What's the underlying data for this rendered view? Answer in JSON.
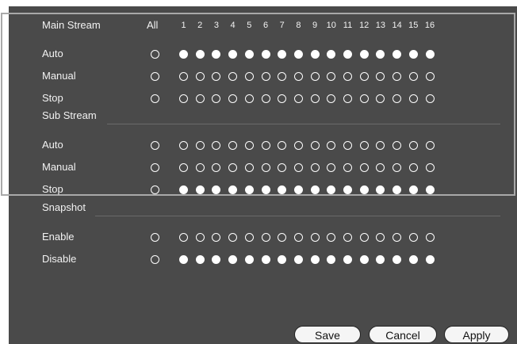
{
  "sections": [
    {
      "id": "main-stream",
      "title": "Main Stream",
      "header_all_label": "All",
      "channel_numbers": [
        "1",
        "2",
        "3",
        "4",
        "5",
        "6",
        "7",
        "8",
        "9",
        "10",
        "11",
        "12",
        "13",
        "14",
        "15",
        "16"
      ],
      "rows": [
        {
          "label": "Auto",
          "all_selected": false,
          "channels": [
            1,
            1,
            1,
            1,
            1,
            1,
            1,
            1,
            1,
            1,
            1,
            1,
            1,
            1,
            1,
            1
          ]
        },
        {
          "label": "Manual",
          "all_selected": false,
          "channels": [
            0,
            0,
            0,
            0,
            0,
            0,
            0,
            0,
            0,
            0,
            0,
            0,
            0,
            0,
            0,
            0
          ]
        },
        {
          "label": "Stop",
          "all_selected": false,
          "channels": [
            0,
            0,
            0,
            0,
            0,
            0,
            0,
            0,
            0,
            0,
            0,
            0,
            0,
            0,
            0,
            0
          ]
        }
      ]
    },
    {
      "id": "sub-stream",
      "title": "Sub Stream",
      "rows": [
        {
          "label": "Auto",
          "all_selected": false,
          "channels": [
            0,
            0,
            0,
            0,
            0,
            0,
            0,
            0,
            0,
            0,
            0,
            0,
            0,
            0,
            0,
            0
          ]
        },
        {
          "label": "Manual",
          "all_selected": false,
          "channels": [
            0,
            0,
            0,
            0,
            0,
            0,
            0,
            0,
            0,
            0,
            0,
            0,
            0,
            0,
            0,
            0
          ]
        },
        {
          "label": "Stop",
          "all_selected": false,
          "channels": [
            1,
            1,
            1,
            1,
            1,
            1,
            1,
            1,
            1,
            1,
            1,
            1,
            1,
            1,
            1,
            1
          ]
        }
      ]
    },
    {
      "id": "snapshot",
      "title": "Snapshot",
      "rows": [
        {
          "label": "Enable",
          "all_selected": false,
          "channels": [
            0,
            0,
            0,
            0,
            0,
            0,
            0,
            0,
            0,
            0,
            0,
            0,
            0,
            0,
            0,
            0
          ]
        },
        {
          "label": "Disable",
          "all_selected": false,
          "channels": [
            1,
            1,
            1,
            1,
            1,
            1,
            1,
            1,
            1,
            1,
            1,
            1,
            1,
            1,
            1,
            1
          ]
        }
      ]
    }
  ],
  "buttons": {
    "save": "Save",
    "cancel": "Cancel",
    "apply": "Apply"
  },
  "colors": {
    "panel_bg": "#4a4a4a",
    "text": "#f2f2f2",
    "frame": "#a9a9a9",
    "button_bg": "#f5f5f5"
  }
}
